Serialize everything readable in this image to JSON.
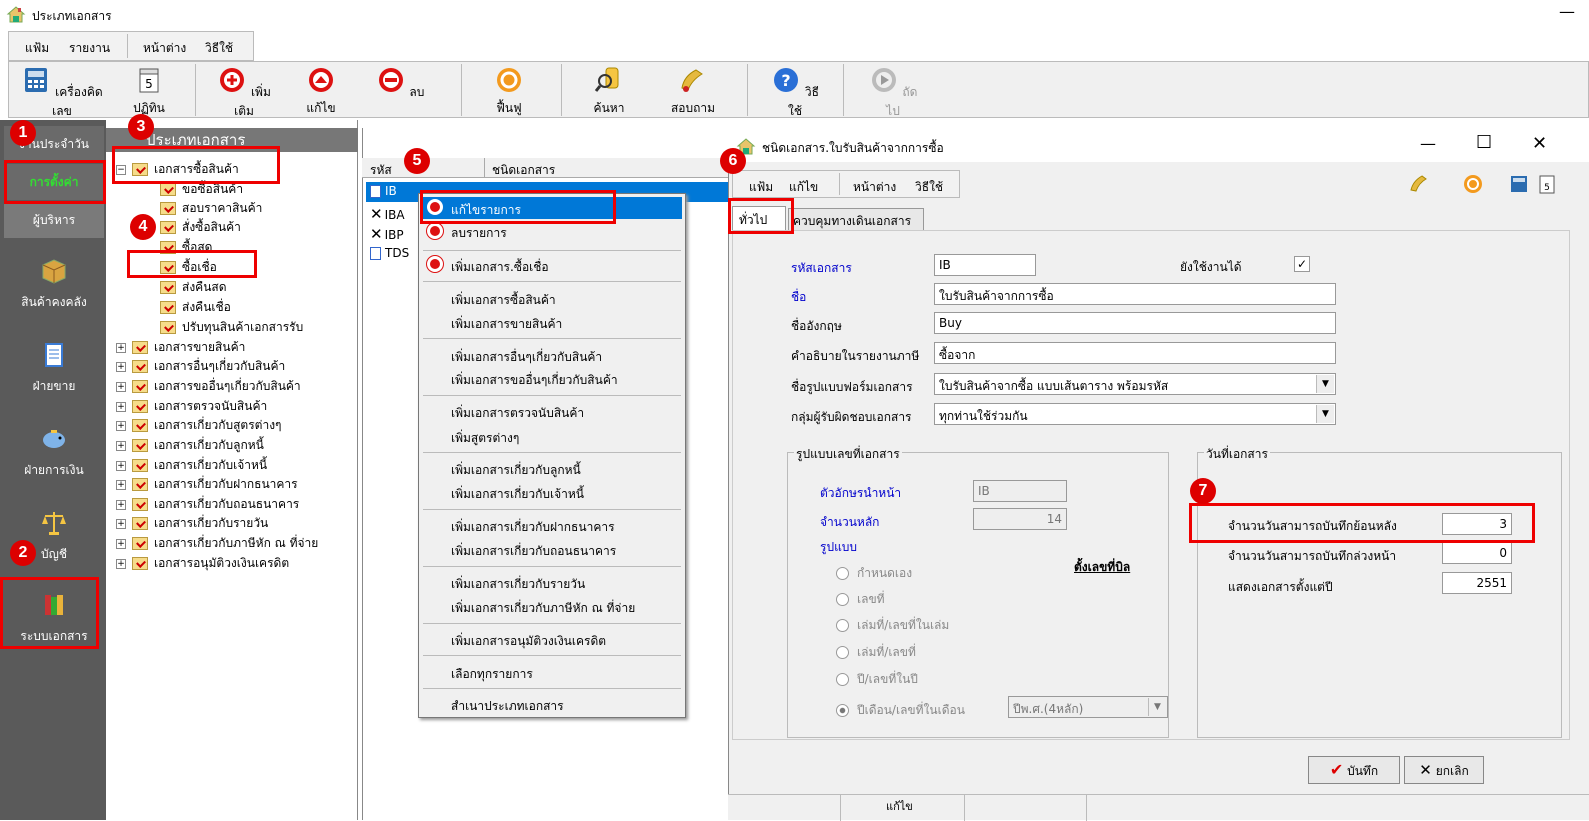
{
  "window": {
    "title": "ประเภทเอกสาร",
    "min_glyph": "—"
  },
  "menu": [
    "แฟ้ม",
    "รายงาน",
    "หน้าต่าง",
    "วิธีใช้"
  ],
  "toolbar": [
    "เครื่องคิดเลข",
    "ปฏิทิน",
    "เพิ่มเติม",
    "แก้ไข",
    "ลบ",
    "ฟื้นฟู",
    "ค้นหา",
    "สอบถาม",
    "วิธีใช้",
    "ถัดไป"
  ],
  "leftnav": {
    "tabs": [
      "งานประจำวัน",
      "การตั้งค่า",
      "ผู้บริหาร"
    ],
    "big": [
      "สินค้าคงคลัง",
      "ฝ่ายขาย",
      "ฝ่ายการเงิน",
      "บัญชี",
      "ระบบเอกสาร"
    ]
  },
  "tree": {
    "header": "ประเภทเอกสาร",
    "root": "เอกสารซื้อสินค้า",
    "children": [
      "ขอซื้อสินค้า",
      "สอบราคาสินค้า",
      "สั่งซื้อสินค้า",
      "ซื้อสด",
      "ซื้อเชื่อ",
      "ส่งคืนสด",
      "ส่งคืนเชื่อ",
      "ปรับทุนสินค้าเอกสารรับ"
    ],
    "others": [
      "เอกสารขายสินค้า",
      "เอกสารอื่นๆเกี่ยวกับสินค้า",
      "เอกสารขออื่นๆเกี่ยวกับสินค้า",
      "เอกสารตรวจนับสินค้า",
      "เอกสารเกี่ยวกับสูตรต่างๆ",
      "เอกสารเกี่ยวกับลูกหนี้",
      "เอกสารเกี่ยวกับเจ้าหนี้",
      "เอกสารเกี่ยวกับฝากธนาคาร",
      "เอกสารเกี่ยวกับถอนธนาคาร",
      "เอกสารเกี่ยวกับรายวัน",
      "เอกสารเกี่ยวกับภาษีหัก ณ ที่จ่าย",
      "เอกสารอนุมัติวงเงินเครดิต"
    ],
    "expand": "+",
    "collapse": "−"
  },
  "list": {
    "headers": [
      "รหัส",
      "ชนิดเอกสาร"
    ],
    "rows": [
      "IB",
      "IBA",
      "IBP",
      "TDS"
    ]
  },
  "context_menu": {
    "items": [
      "แก้ไขรายการ",
      "ลบรายการ",
      "เพิ่มเอกสาร.ซื้อเชื่อ",
      "เพิ่มเอกสารซื้อสินค้า",
      "เพิ่มเอกสารขายสินค้า",
      "เพิ่มเอกสารอื่นๆเกี่ยวกับสินค้า",
      "เพิ่มเอกสารขออื่นๆเกี่ยวกับสินค้า",
      "เพิ่มเอกสารตรวจนับสินค้า",
      "เพิ่มสูตรต่างๆ",
      "เพิ่มเอกสารเกี่ยวกับลูกหนี้",
      "เพิ่มเอกสารเกี่ยวกับเจ้าหนี้",
      "เพิ่มเอกสารเกี่ยวกับฝากธนาคาร",
      "เพิ่มเอกสารเกี่ยวกับถอนธนาคาร",
      "เพิ่มเอกสารเกี่ยวกับรายวัน",
      "เพิ่มเอกสารเกี่ยวกับภาษีหัก ณ ที่จ่าย",
      "เพิ่มเอกสารอนุมัติวงเงินเครดิต",
      "เลือกทุกรายการ",
      "สำเนาประเภทเอกสาร"
    ]
  },
  "dialog": {
    "title": "ชนิดเอกสาร.ใบรับสินค้าจากการซื้อ",
    "controls": [
      "—",
      "☐",
      "✕"
    ],
    "menu": [
      "แฟ้ม",
      "แก้ไข",
      "หน้าต่าง",
      "วิธีใช้"
    ],
    "tabs": [
      "ทั่วไป",
      "ควบคุมทางเดินเอกสาร"
    ],
    "fields": {
      "code_label": "รหัสเอกสาร",
      "code": "IB",
      "active_label": "ยังใช้งานได้",
      "active_check": "✓",
      "name_label": "ชื่อ",
      "name": "ใบรับสินค้าจากการซื้อ",
      "eng_label": "ชื่ออังกฤษ",
      "eng": "Buy",
      "tax_label": "คำอธิบายในรายงานภาษี",
      "tax": "ซื้อจาก",
      "form_label": "ชื่อรูปแบบฟอร์มเอกสาร",
      "form": "ใบรับสินค้าจากซื้อ แบบเส้นตาราง พร้อมรหัส",
      "group_label": "กลุ่มผู้รับผิดชอบเอกสาร",
      "group": "ทุกท่านใช้ร่วมกัน"
    },
    "numbering": {
      "title": "รูปแบบเลขที่เอกสาร",
      "prefix_label": "ตัวอักษรนำหน้า",
      "prefix": "IB",
      "digits_label": "จำนวนหลัก",
      "digits": "14",
      "format_label": "รูปแบบ",
      "setup_link": "ตั้งเลขที่บิล",
      "options": [
        "กำหนดเอง",
        "เลขที่",
        "เล่มที่/เลขที่ในเล่ม",
        "เล่มที่/เลขที่",
        "ปี/เลขที่ในปี",
        "ปีเดือน/เลขที่ในเดือน"
      ],
      "year_fmt": "ปีพ.ศ.(4หลัก)"
    },
    "date": {
      "title": "วันที่เอกสาร",
      "back_label": "จำนวนวันสามารถบันทึกย้อนหลัง",
      "back": "3",
      "fwd_label": "จำนวนวันสามารถบันทึกล่วงหน้า",
      "fwd": "0",
      "year_label": "แสดงเอกสารตั้งแต่ปี",
      "year": "2551"
    },
    "save": "บันทึก",
    "cancel": "ยกเลิก",
    "status": "แก้ไข"
  },
  "annotations": [
    "1",
    "2",
    "3",
    "4",
    "5",
    "6",
    "7"
  ],
  "colors": {
    "annotation": "#ee0000",
    "highlight": "#0078d7",
    "nav_bg": "#5a5a5a",
    "active_tab_text": "#33dd33"
  }
}
